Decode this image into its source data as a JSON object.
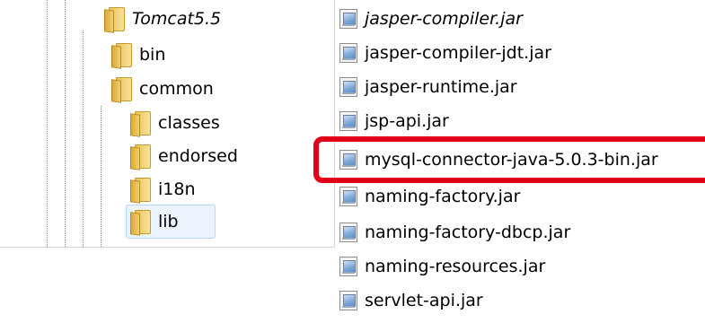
{
  "tree": {
    "items": [
      {
        "label": "Tomcat5.5",
        "italic": true,
        "selected": false
      },
      {
        "label": "bin",
        "italic": false,
        "selected": false
      },
      {
        "label": "common",
        "italic": false,
        "selected": false
      },
      {
        "label": "classes",
        "italic": false,
        "selected": false
      },
      {
        "label": "endorsed",
        "italic": false,
        "selected": false
      },
      {
        "label": "i18n",
        "italic": false,
        "selected": false
      },
      {
        "label": "lib",
        "italic": false,
        "selected": true
      }
    ]
  },
  "files": {
    "items": [
      {
        "name": "jasper-compiler.jar",
        "italic": true
      },
      {
        "name": "jasper-compiler-jdt.jar",
        "italic": false
      },
      {
        "name": "jasper-runtime.jar",
        "italic": false
      },
      {
        "name": "jsp-api.jar",
        "italic": false
      },
      {
        "name": "mysql-connector-java-5.0.3-bin.jar",
        "italic": false,
        "highlighted": true
      },
      {
        "name": "naming-factory.jar",
        "italic": false
      },
      {
        "name": "naming-factory-dbcp.jar",
        "italic": false
      },
      {
        "name": "naming-resources.jar",
        "italic": false
      },
      {
        "name": "servlet-api.jar",
        "italic": false
      }
    ]
  },
  "colors": {
    "highlight": "#e0001a",
    "selection_bg": "#ebf3fc",
    "selection_border": "#b8d6fb"
  }
}
